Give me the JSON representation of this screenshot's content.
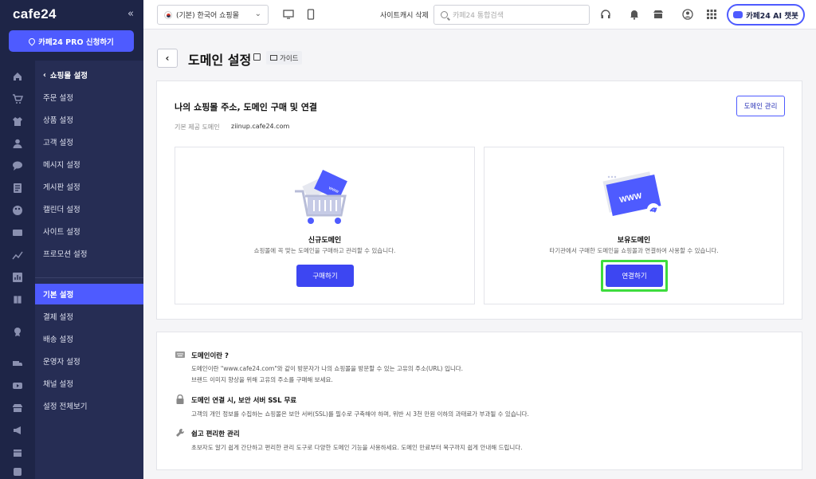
{
  "sidebar": {
    "logo": "cafe24",
    "collapse": "«",
    "pro_button": "카페24 PRO 신청하기",
    "back_label": "쇼핑몰 설정",
    "items": [
      {
        "label": "주문 설정"
      },
      {
        "label": "상품 설정"
      },
      {
        "label": "고객 설정"
      },
      {
        "label": "메시지 설정"
      },
      {
        "label": "게시판 설정"
      },
      {
        "label": "캘린더 설정"
      },
      {
        "label": "사이트 설정"
      },
      {
        "label": "프로모션 설정"
      }
    ],
    "items2": [
      {
        "label": "기본 설정",
        "active": true
      },
      {
        "label": "결제 설정"
      },
      {
        "label": "배송 설정"
      },
      {
        "label": "운영자 설정"
      },
      {
        "label": "채널 설정"
      },
      {
        "label": "설정 전체보기"
      }
    ],
    "rail_icons": [
      "home-icon",
      "cart-icon",
      "shirt-icon",
      "user-icon",
      "chat-icon",
      "board-icon",
      "palette-icon",
      "monitor-icon",
      "chart-icon",
      "stats-icon",
      "book-icon",
      "badge-icon",
      "truck-icon",
      "video-icon",
      "store-icon",
      "megaphone-icon",
      "box-icon",
      "app-icon"
    ]
  },
  "header": {
    "mall_select": "(기본) 한국어 쇼핑몰",
    "cache_delete": "사이트캐시 삭제",
    "search_placeholder": "카페24 통합검색",
    "chatbot": "카페24 AI 챗봇"
  },
  "page": {
    "title": "도메인 설정",
    "guide": "가이드"
  },
  "main": {
    "section_title": "나의 쇼핑몰 주소, 도메인 구매 및 연결",
    "manage_button": "도메인 관리",
    "default_label": "기본 제공 도메인",
    "default_value": "ziinup.cafe24.com",
    "new_domain": {
      "title": "신규도메인",
      "desc": "쇼핑몰에 꼭 맞는 도메인을 구매하고 관리할 수 있습니다.",
      "button": "구매하기",
      "illus_text": "www"
    },
    "own_domain": {
      "title": "보유도메인",
      "desc": "타기관에서 구매한 도메인을 쇼핑몰과 연결하여 사용할 수 있습니다.",
      "button": "연결하기",
      "illus_text": "WWW"
    }
  },
  "info": [
    {
      "title": "도메인이란 ?",
      "lines": [
        "도메인이란 \"www.cafe24.com\"와 같이 방문자가 나의 쇼핑몰을 방문할 수 있는 고유의 주소(URL) 입니다.",
        "브랜드 이미지 향상을 위해 고유의 주소를 구매해 보세요."
      ]
    },
    {
      "title": "도메인 연결 시, 보안 서버 SSL 무료",
      "lines": [
        "고객의 개인 정보를 수집하는 쇼핑몰은 보안 서버(SSL)를 필수로 구축해야 하며, 위반 시 3천 만원 이하의 과태료가 부과될 수 있습니다."
      ]
    },
    {
      "title": "쉽고 편리한 관리",
      "lines": [
        "초보자도 알기 쉽게 간단하고 편리한 관리 도구로 다양한 도메인 기능을 사용하세요. 도메인 만료부터 복구까지 쉽게 안내해 드립니다."
      ]
    }
  ],
  "colors": {
    "accent": "#4e5bff",
    "sidebar": "#1e2547",
    "highlight": "#3ddc3d"
  }
}
